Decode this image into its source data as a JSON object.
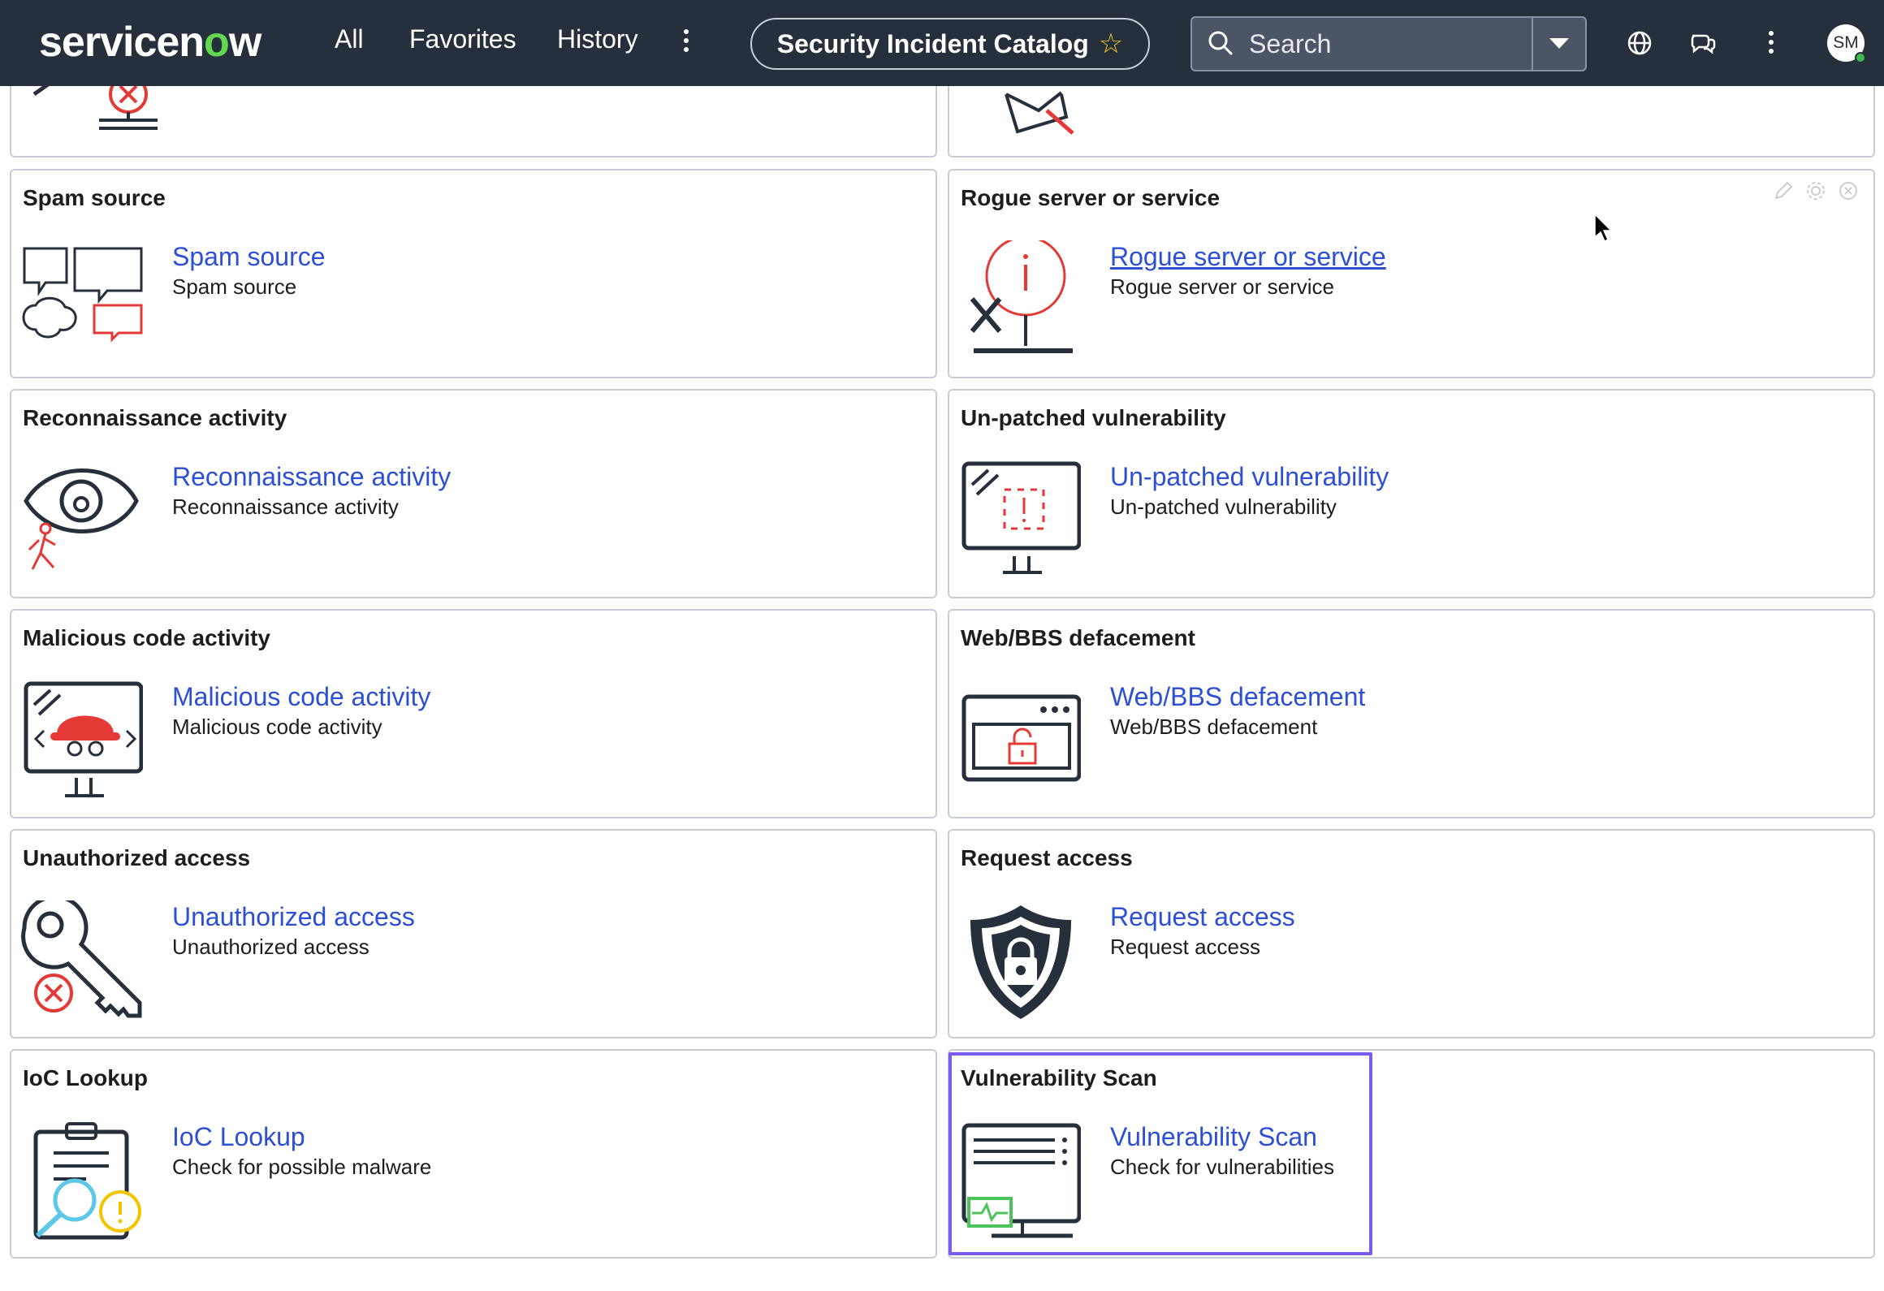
{
  "nav": {
    "logo_prefix": "servicen",
    "logo_o": "o",
    "logo_suffix": "w",
    "all": "All",
    "favorites": "Favorites",
    "history": "History",
    "context_title": "Security Incident Catalog",
    "search_placeholder": "Search",
    "avatar_initials": "SM"
  },
  "colors": {
    "nav_bg": "#26303d",
    "link": "#2c4fd6",
    "highlight": "#7b5cf0",
    "icon_red": "#e53935"
  },
  "cards": [
    {
      "title": "Spam source",
      "link": "Spam source",
      "desc": "Spam source",
      "icon": "spam-chat-bubbles-icon"
    },
    {
      "title": "Rogue server or service",
      "link": "Rogue server or service",
      "desc": "Rogue server or service",
      "icon": "rogue-server-icon"
    },
    {
      "title": "Reconnaissance activity",
      "link": "Reconnaissance activity",
      "desc": "Reconnaissance activity",
      "icon": "eye-walker-icon"
    },
    {
      "title": "Un-patched vulnerability",
      "link": "Un-patched vulnerability",
      "desc": "Un-patched vulnerability",
      "icon": "monitor-alert-icon"
    },
    {
      "title": "Malicious code activity",
      "link": "Malicious code activity",
      "desc": "Malicious code activity",
      "icon": "monitor-spy-icon"
    },
    {
      "title": "Web/BBS defacement",
      "link": "Web/BBS defacement",
      "desc": "Web/BBS defacement",
      "icon": "browser-unlock-icon"
    },
    {
      "title": "Unauthorized access",
      "link": "Unauthorized access",
      "desc": "Unauthorized access",
      "icon": "key-denied-icon"
    },
    {
      "title": "Request access",
      "link": "Request access",
      "desc": "Request access",
      "icon": "shield-lock-icon"
    },
    {
      "title": "IoC Lookup",
      "link": "IoC Lookup",
      "desc": "Check for possible malware",
      "icon": "clipboard-search-icon"
    },
    {
      "title": "Vulnerability Scan",
      "link": "Vulnerability Scan",
      "desc": "Check for vulnerabilities",
      "icon": "monitor-scan-icon"
    }
  ]
}
